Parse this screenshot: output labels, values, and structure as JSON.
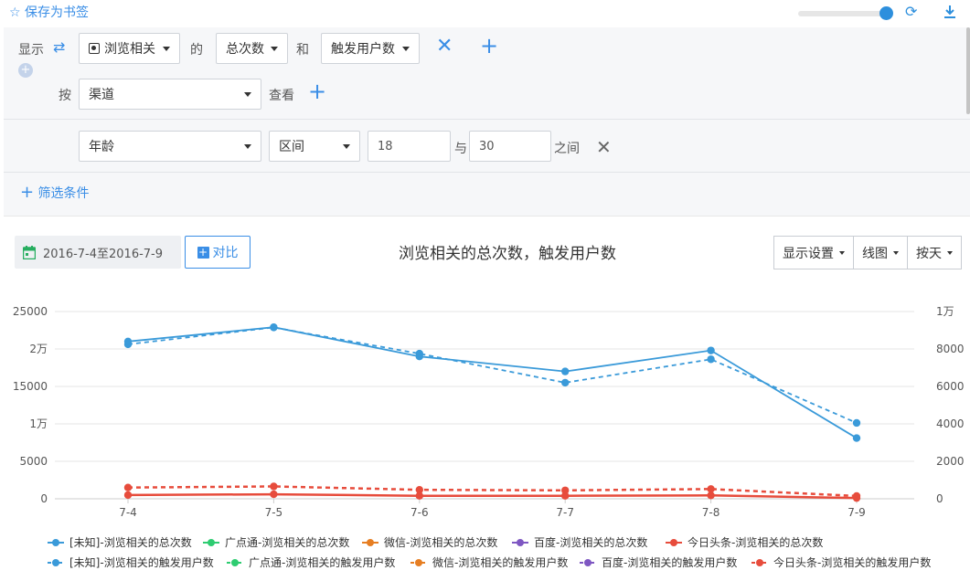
{
  "toolbar": {
    "bookmark_label": "☆ 保存为书签",
    "slider_value": 0.9
  },
  "query": {
    "show_label": "显示",
    "event": "浏览相关",
    "of_label": "的",
    "metric1": "总次数",
    "and_label": "和",
    "metric2": "触发用户数",
    "by_label": "按",
    "group_by": "渠道",
    "view_label": "查看",
    "filter_field": "年龄",
    "filter_op": "区间",
    "filter_min": "18",
    "with_label": "与",
    "filter_max": "30",
    "between_label": "之间",
    "add_filter_label": "筛选条件"
  },
  "controls": {
    "date_range": "2016-7-4至2016-7-9",
    "compare_label": "对比",
    "display_settings": "显示设置",
    "chart_type": "线图",
    "granularity": "按天"
  },
  "chart_data": {
    "type": "line",
    "title": "浏览相关的总次数，触发用户数",
    "categories": [
      "7-4",
      "7-5",
      "7-6",
      "7-7",
      "7-8",
      "7-9"
    ],
    "y_left_ticks": [
      "0",
      "5000",
      "1万",
      "15000",
      "2万",
      "25000"
    ],
    "y_left_range": [
      0,
      25000
    ],
    "y_right_ticks": [
      "0",
      "2000",
      "4000",
      "6000",
      "8000",
      "1万"
    ],
    "y_right_range": [
      0,
      10000
    ],
    "series": [
      {
        "name": "[未知]-浏览相关的总次数",
        "axis": "left",
        "style": "solid",
        "color": "#3a9ad9",
        "values": [
          21000,
          22900,
          19000,
          17000,
          19800,
          8100
        ]
      },
      {
        "name": "广点通-浏览相关的总次数",
        "axis": "left",
        "style": "solid",
        "color": "#2ecc71",
        "values": [
          null,
          null,
          null,
          null,
          null,
          null
        ]
      },
      {
        "name": "微信-浏览相关的总次数",
        "axis": "left",
        "style": "solid",
        "color": "#e67e22",
        "values": [
          null,
          null,
          null,
          null,
          null,
          null
        ]
      },
      {
        "name": "百度-浏览相关的总次数",
        "axis": "left",
        "style": "solid",
        "color": "#7e57c2",
        "values": [
          null,
          null,
          null,
          null,
          null,
          null
        ]
      },
      {
        "name": "今日头条-浏览相关的总次数",
        "axis": "left",
        "style": "solid",
        "color": "#e74c3c",
        "values": [
          500,
          600,
          400,
          400,
          450,
          100
        ]
      },
      {
        "name": "[未知]-浏览相关的触发用户数",
        "axis": "right",
        "style": "dashed",
        "color": "#3a9ad9",
        "values": [
          8250,
          9150,
          7750,
          6200,
          7450,
          4050
        ]
      },
      {
        "name": "广点通-浏览相关的触发用户数",
        "axis": "right",
        "style": "dashed",
        "color": "#2ecc71",
        "values": [
          null,
          null,
          null,
          null,
          null,
          null
        ]
      },
      {
        "name": "微信-浏览相关的触发用户数",
        "axis": "right",
        "style": "dashed",
        "color": "#e67e22",
        "values": [
          null,
          null,
          null,
          null,
          null,
          null
        ]
      },
      {
        "name": "百度-浏览相关的触发用户数",
        "axis": "right",
        "style": "dashed",
        "color": "#7e57c2",
        "values": [
          null,
          null,
          null,
          null,
          null,
          null
        ]
      },
      {
        "name": "今日头条-浏览相关的触发用户数",
        "axis": "right",
        "style": "dashed",
        "color": "#e74c3c",
        "values": [
          600,
          660,
          480,
          450,
          520,
          150
        ]
      }
    ],
    "legend_position": "bottom",
    "grid": "horizontal"
  }
}
